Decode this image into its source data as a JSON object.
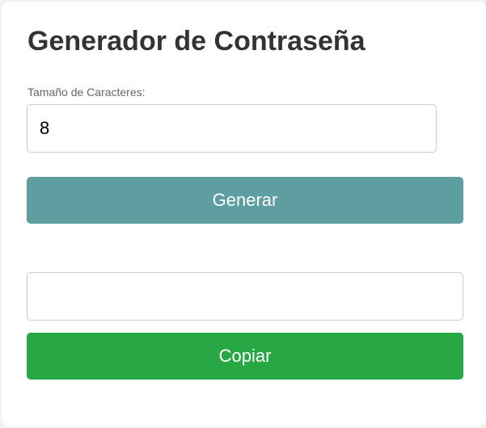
{
  "app": {
    "title": "Generador de Contraseña"
  },
  "size_field": {
    "label": "Tamaño de Caracteres:",
    "value": "8"
  },
  "actions": {
    "generate_label": "Generar",
    "copy_label": "Copiar"
  },
  "output": {
    "value": ""
  },
  "colors": {
    "generate_button": "#5f9ea0",
    "copy_button": "#28a745",
    "title_text": "#333333"
  }
}
